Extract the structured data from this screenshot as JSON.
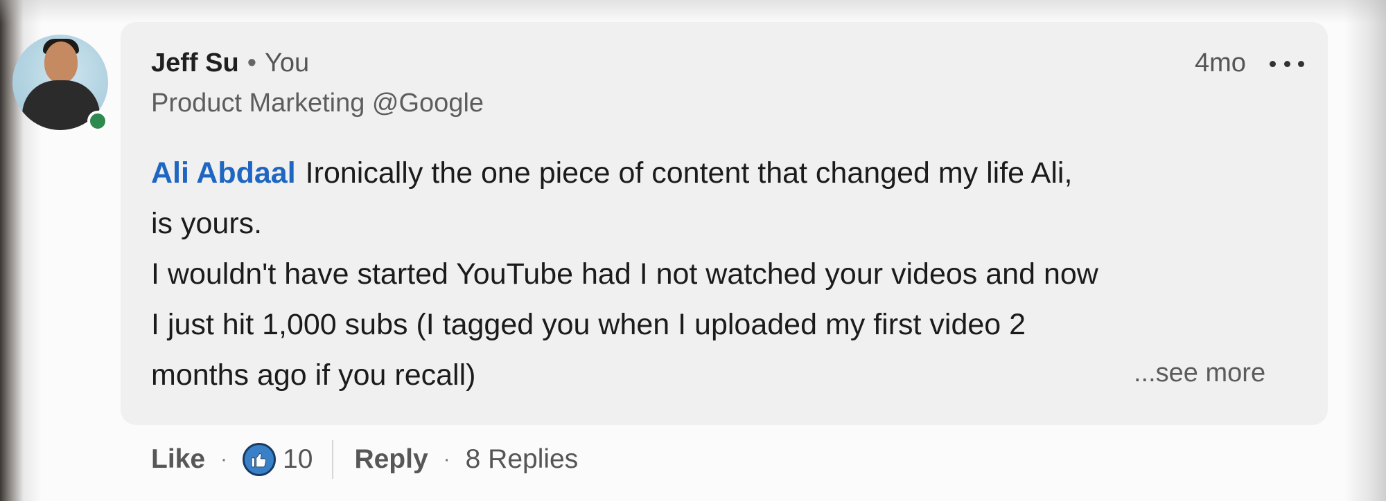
{
  "comment": {
    "author_name": "Jeff Su",
    "separator": "•",
    "author_relation": "You",
    "author_headline": "Product Marketing @Google",
    "timestamp": "4mo",
    "mention": "Ali Abdaal",
    "body_lines": [
      "Ironically the one piece of content that changed my life Ali,",
      "is yours.",
      "I wouldn't have started YouTube had I not watched your videos and now",
      "I just hit 1,000 subs (I tagged you when I uploaded my first video 2",
      "months ago if you recall)"
    ],
    "see_more_label": "...see more"
  },
  "actions": {
    "like_label": "Like",
    "dot": "·",
    "like_count": "10",
    "reply_label": "Reply",
    "replies_label": "8 Replies"
  },
  "icons": {
    "more": "more-horizontal-icon",
    "like_reaction": "thumbs-up-icon",
    "presence": "online-status-icon"
  },
  "colors": {
    "mention": "#1f66c2",
    "like_badge": "#3a80c9",
    "presence": "#2e8a4e",
    "bubble": "#f0f0f0"
  }
}
